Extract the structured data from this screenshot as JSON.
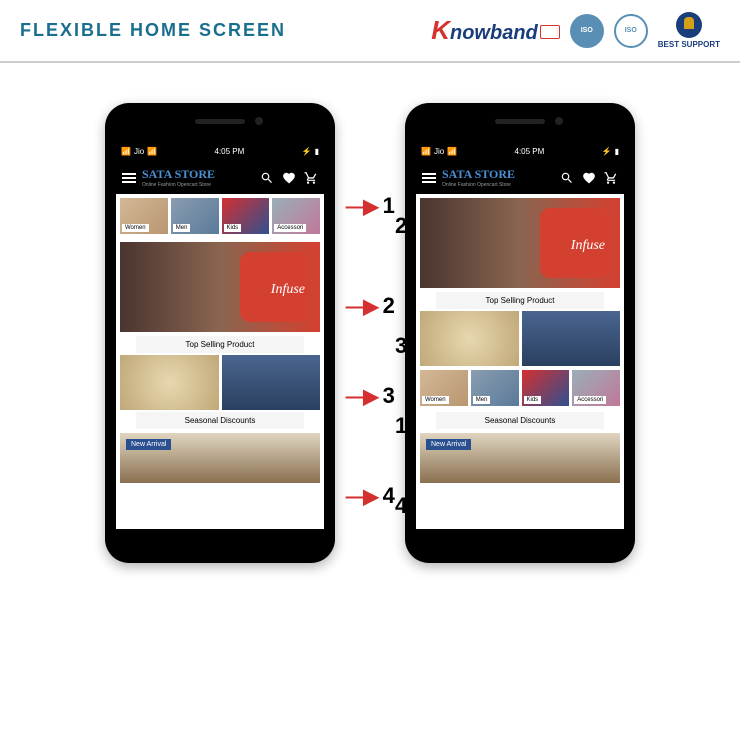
{
  "header": {
    "title": "FLEXIBLE HOME SCREEN",
    "brand_k": "K",
    "brand_rest": "nowband",
    "iso1": "ISO",
    "iso2": "ISO",
    "support": "BEST SUPPORT"
  },
  "status": {
    "carrier": "Jio",
    "time": "4:05 PM"
  },
  "app": {
    "store_name": "SATA STORE",
    "store_sub": "Online Fashion Opencart Store"
  },
  "categories": [
    "Women",
    "Men",
    "Kids",
    "Accessori"
  ],
  "banner_text": "Infuse",
  "sections": {
    "top_selling": "Top Selling Product",
    "seasonal": "Seasonal Discounts",
    "new_arrival": "New Arrival"
  },
  "pointers_left": [
    "1",
    "2",
    "3",
    "4"
  ],
  "pointers_right": [
    "2",
    "3",
    "1",
    "4"
  ]
}
